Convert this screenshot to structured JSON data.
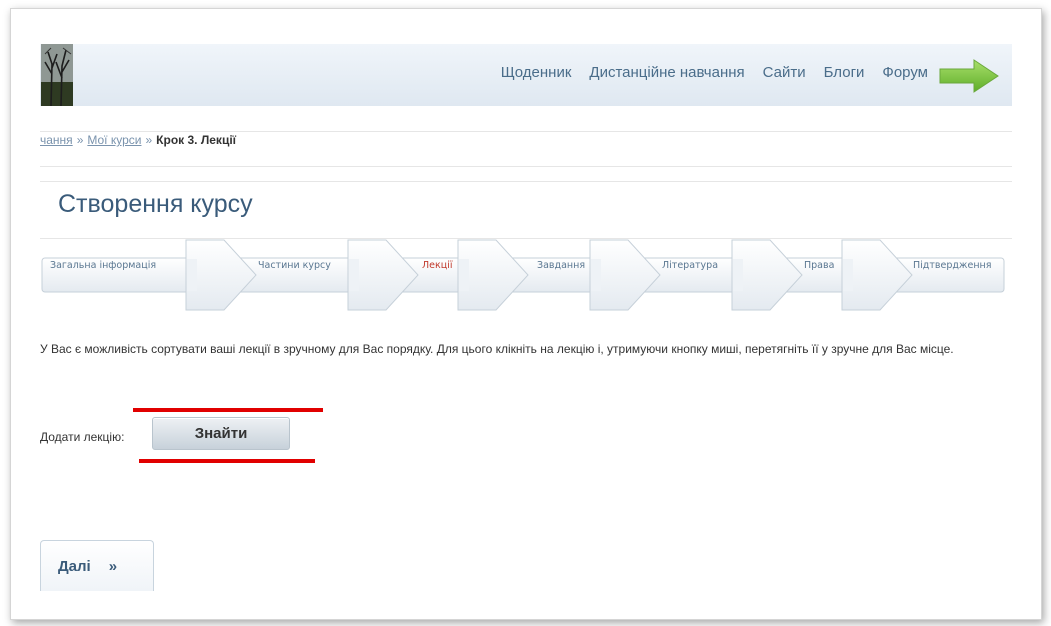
{
  "nav": {
    "items": [
      "Щоденник",
      "Дистанційне навчання",
      "Сайти",
      "Блоги",
      "Форум"
    ]
  },
  "breadcrumb": {
    "link1": "чання",
    "link2": "Мої курси",
    "separator": "»",
    "current": "Крок 3. Лекції"
  },
  "page": {
    "title": "Створення курсу"
  },
  "steps": {
    "active_index": 2,
    "items": [
      "Загальна інформація",
      "Частини курсу",
      "Лекції",
      "Завдання",
      "Література",
      "Права",
      "Підтвердження"
    ]
  },
  "info": {
    "text": "У Вас є можливість сортувати ваші лекції в зручному для Вас порядку. Для цього клікніть на лекцію і, утримуючи кнопку миші, перетягніть її у зручне для Вас місце."
  },
  "add_lecture": {
    "label": "Додати лекцію:",
    "button": "Знайти"
  },
  "next": {
    "label": "Далі",
    "icon": "»"
  },
  "colors": {
    "accent": "#3a5b7a",
    "active_step": "#c0392b",
    "highlight": "#e10000",
    "arrow_green": "#7cc242"
  }
}
